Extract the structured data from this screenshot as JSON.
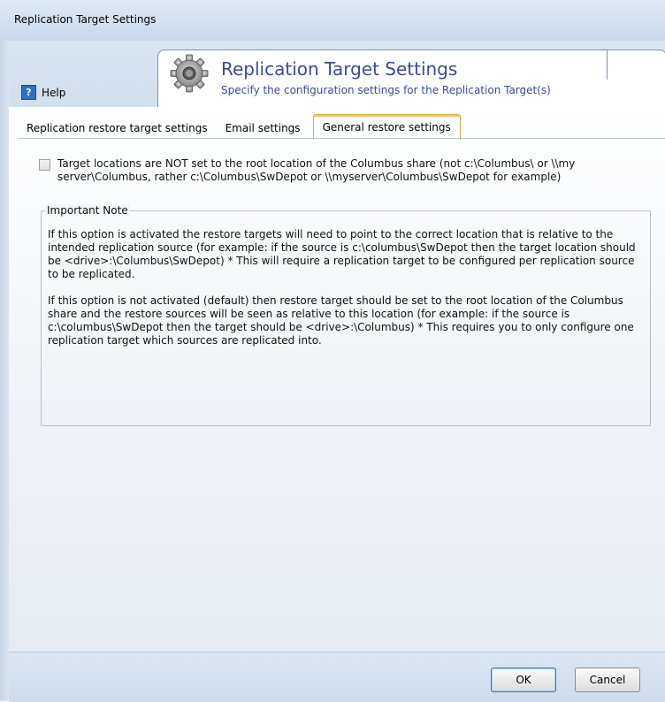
{
  "window": {
    "title": "Replication Target Settings"
  },
  "header": {
    "help_label": "Help",
    "title": "Replication Target Settings",
    "subtitle": "Specify the configuration settings for the Replication Target(s)"
  },
  "tabs": [
    {
      "label": "Replication restore target settings",
      "active": false
    },
    {
      "label": "Email settings",
      "active": false
    },
    {
      "label": "General restore settings",
      "active": true
    }
  ],
  "general": {
    "checkbox_label": "Target locations are NOT set to the root location of the Columbus share (not c:\\Columbus\\ or \\\\my server\\Columbus, rather c:\\Columbus\\SwDepot or \\\\myserver\\Columbus\\SwDepot for example)",
    "checkbox_checked": false,
    "note_title": "Important Note",
    "note_paragraph_1": "If this option is activated the restore targets will need to point to the correct location that is relative to the intended replication source (for example: if the source is c:\\columbus\\SwDepot then the target location should be <drive>:\\Columbus\\SwDepot) * This will require a replication target to be configured per replication source to be replicated.",
    "note_paragraph_2": "If this option is not activated (default) then restore target should be set to the root location of the Columbus share and the restore sources will be seen as relative to this location (for example: if the source is c:\\columbus\\SwDepot then the target should be <drive>:\\Columbus) * This requires you to only configure one replication target which sources are replicated into."
  },
  "footer": {
    "ok_label": "OK",
    "cancel_label": "Cancel"
  },
  "colors": {
    "title_blue": "#3b4aa1",
    "active_tab_border": "#e3a93b",
    "help_icon": "#2f6fc5"
  },
  "icons": {
    "help": "question-mark-icon",
    "settings": "gear-icon"
  }
}
